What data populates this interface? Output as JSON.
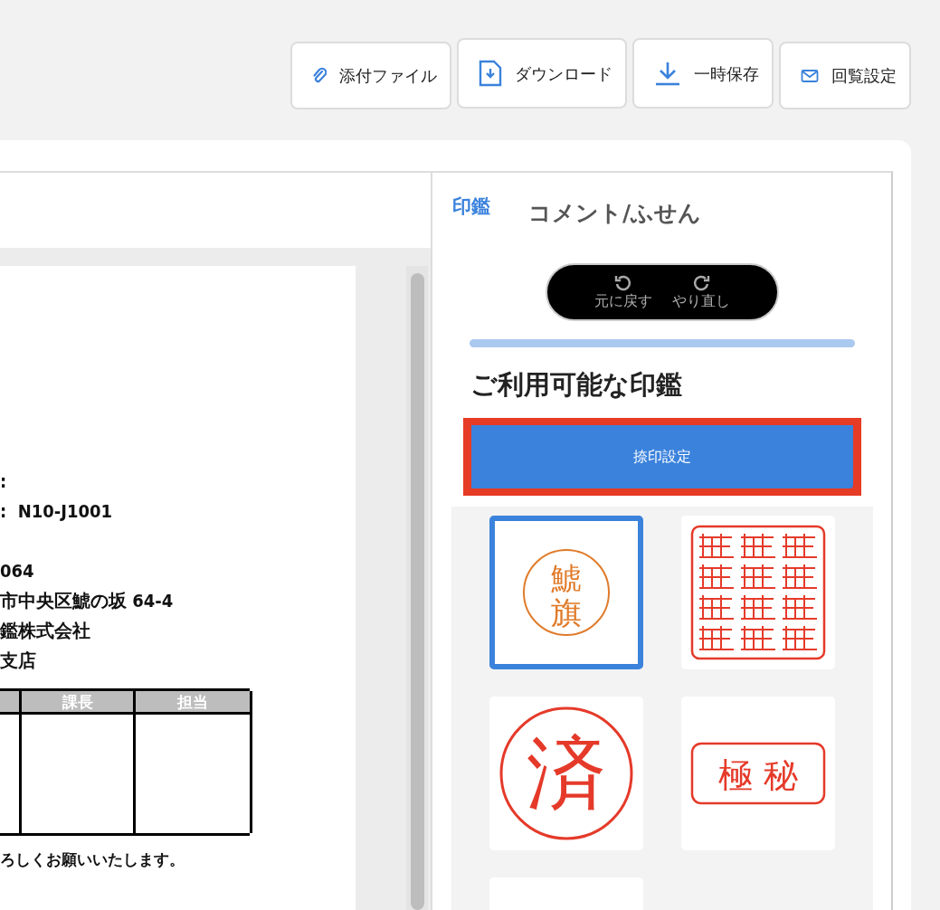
{
  "toolbar": [
    {
      "kind": "clip",
      "label": "添付ファイル"
    },
    {
      "kind": "file-down",
      "label": "ダウンロード"
    },
    {
      "kind": "download",
      "label": "一時保存"
    },
    {
      "kind": "mail",
      "label": "回覧設定"
    }
  ],
  "document": {
    "reference_lines": [
      ":",
      ":  N10-J1001"
    ],
    "address_lines": [
      "064",
      "市中央区鯱の坂 64-4",
      "鑑株式会社",
      "支店"
    ],
    "approval_table": {
      "columns": [
        "",
        "課長",
        "担当"
      ]
    },
    "closing": "ろしくお願いいたします。"
  },
  "side_panel": {
    "tabs": [
      {
        "label": "印鑑",
        "selected": true
      },
      {
        "label": "コメント/ふせん",
        "selected": false
      }
    ],
    "history": [
      {
        "kind": "undo",
        "label": "元に戻す"
      },
      {
        "kind": "redo",
        "label": "やり直し"
      }
    ],
    "heading": "ご利用可能な印鑑",
    "settings_button": {
      "label": "捺印設定",
      "highlighted": true
    },
    "stamps": [
      {
        "kind": "round",
        "text": "鯱旗",
        "color": "#e07b2a",
        "selected": true
      },
      {
        "kind": "seal",
        "color": "#e53a2a",
        "selected": false
      },
      {
        "kind": "round-large",
        "text": "済",
        "color": "#e53a2a",
        "selected": false
      },
      {
        "kind": "rect",
        "text": "極 秘",
        "color": "#e53a2a",
        "selected": false
      },
      {
        "kind": "blank",
        "selected": false
      }
    ]
  }
}
